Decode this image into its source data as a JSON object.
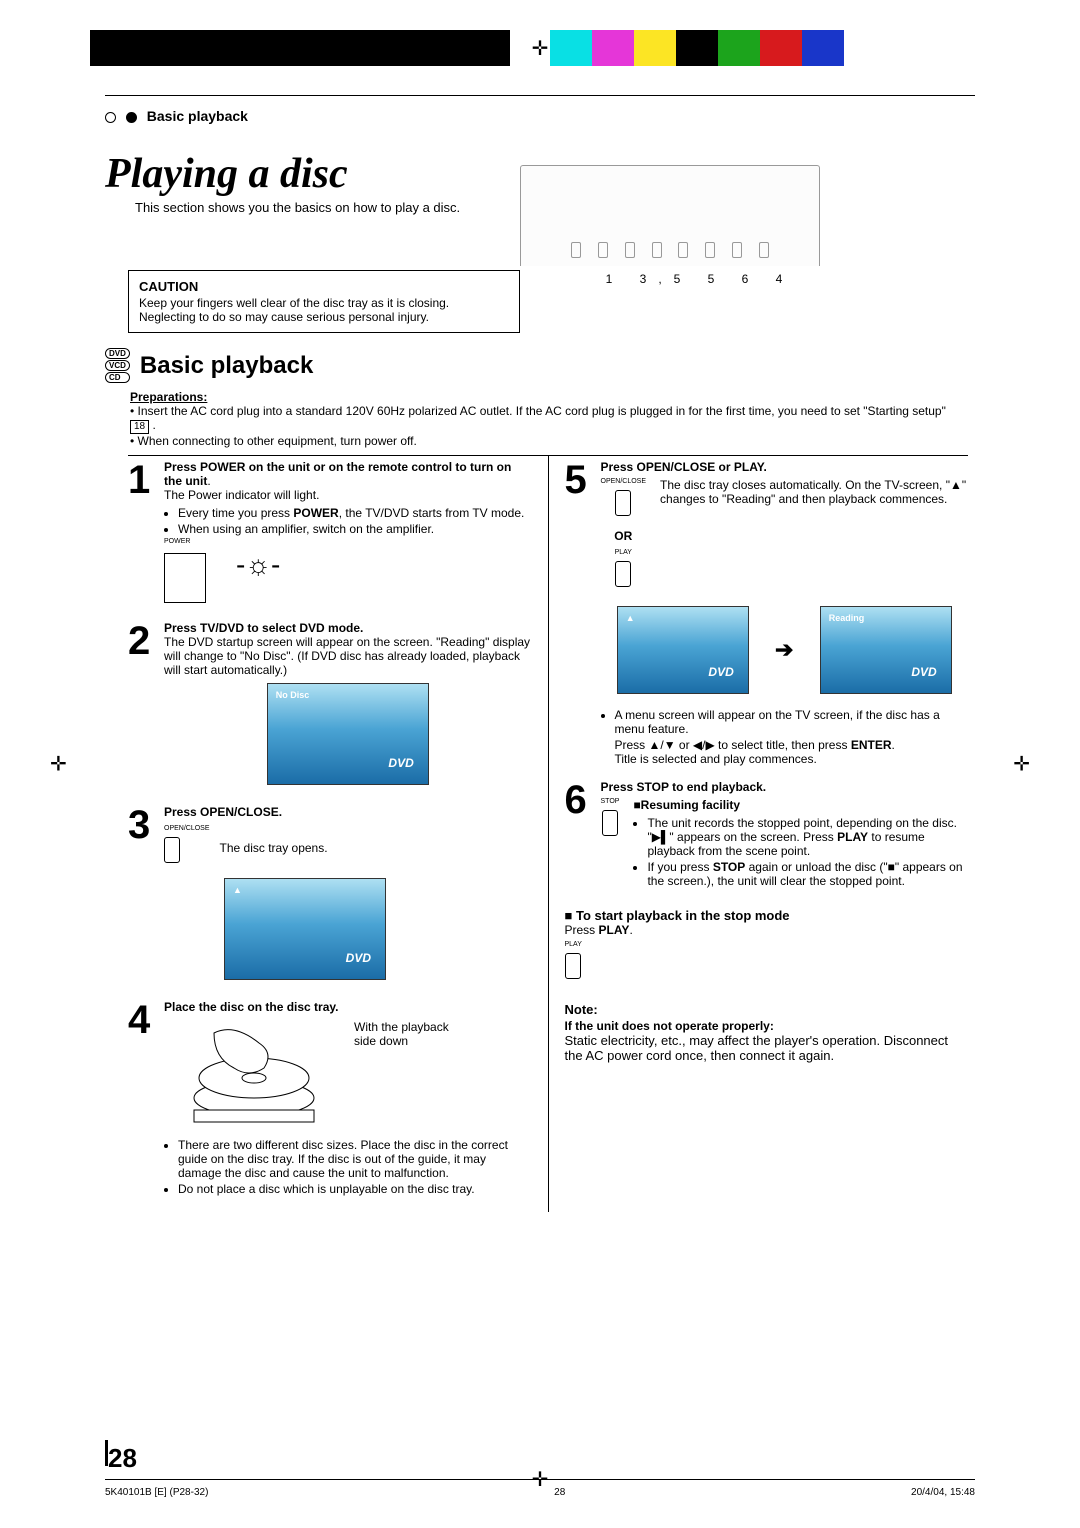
{
  "header": {
    "running_head": "Basic playback"
  },
  "title": {
    "main": "Playing a disc",
    "intro": "This section shows you the basics on how to play a disc."
  },
  "caution": {
    "head": "CAUTION",
    "body": "Keep your fingers well clear of the disc tray as it is closing. Neglecting to do so may cause serious personal injury."
  },
  "device_callouts": "1 3,5  5 6 4",
  "section_heading": "Basic playback",
  "disc_types": [
    "DVD",
    "VCD",
    "CD"
  ],
  "prep": {
    "head": "Preparations:",
    "items": [
      "Insert the AC cord plug into a standard 120V 60Hz polarized AC outlet. If the AC cord plug is plugged in for the first time, you need to set \"Starting setup\"",
      "When connecting to other equipment, turn power off."
    ],
    "page_ref": "18"
  },
  "steps_left": {
    "s1": {
      "head": "Press POWER on the unit or on the remote control to turn on the unit",
      "line1": "The Power indicator will light.",
      "b1": "Every time you press",
      "b1_bold": "POWER",
      "b1_after": ", the TV/DVD starts from TV mode.",
      "b2": "When using an amplifier, switch on the amplifier.",
      "btn": "POWER"
    },
    "s2": {
      "head": "Press TV/DVD to select DVD mode.",
      "line": "The DVD startup screen will appear on the screen. \"Reading\" display will change to \"No Disc\". (If DVD disc has already loaded, playback will start automatically.)",
      "screen_label": "No Disc"
    },
    "s3": {
      "head": "Press OPEN/CLOSE.",
      "line": "The disc tray opens.",
      "btn": "OPEN/CLOSE",
      "eject": "▲"
    },
    "s4": {
      "head": "Place the disc on the disc tray.",
      "side_note": "With the playback side down",
      "bullet1": "There are two different disc sizes. Place the disc in the correct guide on the disc tray. If the disc is out of the guide, it may damage the disc and cause the unit to malfunction.",
      "bullet2": "Do not place a disc which is unplayable on the disc tray."
    }
  },
  "steps_right": {
    "s5": {
      "head": "Press OPEN/CLOSE or PLAY.",
      "btn1": "OPEN/CLOSE",
      "or": "OR",
      "btn2": "PLAY",
      "line1": "The disc tray closes automatically. On the TV-screen, \"▲\" changes to \"Reading\" and then playback commences.",
      "screen_a": "▲",
      "screen_b": "Reading",
      "menu_note": "A menu screen will appear on the TV screen, if the disc has a menu feature.",
      "menu_line": "Press ▲/▼ or ◀/▶ to select title, then press",
      "enter": "ENTER",
      "menu_tail": "Title is selected and play commences."
    },
    "s6": {
      "head": "Press STOP to end playback.",
      "btn": "STOP",
      "resume_head": "■Resuming facility",
      "r1a": "The unit records the stopped point, depending on the disc. \"▶▌\" appears on the screen. Press",
      "play_bold": "PLAY",
      "r1b": "to resume playback from the scene point.",
      "r2a": "If you press",
      "stop_bold": "STOP",
      "r2b": "again or unload the disc (\"■\" appears on the screen.), the unit will clear the stopped point."
    },
    "to_start": {
      "head": "■ To start playback in the stop mode",
      "line": "Press",
      "play": "PLAY",
      "btn": "PLAY"
    },
    "note": {
      "head": "Note:",
      "subhead": "If the unit does not operate properly:",
      "body": "Static electricity, etc., may affect the player's operation. Disconnect the AC power cord once, then connect it again."
    }
  },
  "page_number": "28",
  "footer": {
    "left": "5K40101B [E] (P28-32)",
    "center": "28",
    "right": "20/4/04, 15:48"
  },
  "colorbar": [
    "#000",
    "#000",
    "#000",
    "#000",
    "#000",
    "#000",
    "#000",
    "#000",
    "#000",
    "#000",
    "",
    "",
    "#09e0e4",
    "#e536d8",
    "#fce524",
    "#000",
    "#1ca41c",
    "#d71a1d",
    "#1936c9"
  ]
}
